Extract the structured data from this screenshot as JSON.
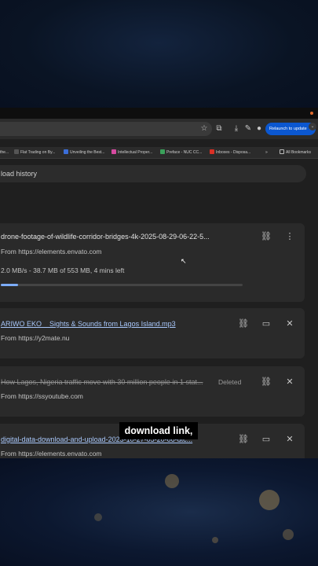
{
  "toolbar": {
    "relaunch_label": "Relaunch to update",
    "icons": [
      "star-icon",
      "extensions-icon",
      "download-icon",
      "puzzle-icon",
      "profile-avatar",
      "menu-dots-icon"
    ]
  },
  "bookmarks": {
    "items": [
      {
        "label": "the..."
      },
      {
        "label": "Flat Trading on By..."
      },
      {
        "label": "Unveiling the Best..."
      },
      {
        "label": "Intellectual Proper..."
      },
      {
        "label": "Preface - NUC CC..."
      },
      {
        "label": "Inboxes - Disposa..."
      }
    ],
    "overflow": "»",
    "all_bookmarks": "All Bookmarks"
  },
  "search": {
    "text": "load history"
  },
  "downloads": [
    {
      "filename": "drone-footage-of-wildlife-corridor-bridges-4k-2025-08-29-06-22-5...",
      "source": "From https://elements.envato.com",
      "progress_text": "2.0 MB/s - 38.7 MB of 553 MB, 4 mins left",
      "progress": 0.07
    },
    {
      "filename": "ARIWO EKO _ Sights & Sounds from Lagos Island.mp3",
      "source": "From https://y2mate.nu"
    },
    {
      "filename": "How Lagos, Nigeria traffic move with 30 million people in 1 stat...",
      "source": "From https://ssyoutube.com",
      "status": "Deleted"
    },
    {
      "filename": "digital-data-download-and-upload-2023-10-27-05-20-06-utc...",
      "source": "From https://elements.envato.com"
    }
  ],
  "caption": "download link,"
}
